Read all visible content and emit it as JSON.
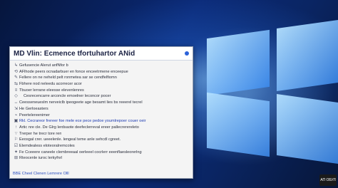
{
  "window": {
    "title": "MD Vlin: Ecmence tfortuhartor ANid"
  },
  "rows": [
    {
      "icon": "↳",
      "text": "Gefusencie Alerut anfNfor b",
      "style": "normal"
    },
    {
      "icon": "⟲",
      "text": "AFlhode peers ocnadarbuer en fonce enceetrmene enceepue",
      "style": "normal"
    },
    {
      "icon": "✎",
      "text": "Fellere on ne neheld pelt ronmetea sar se cendfelfiomn",
      "style": "normal"
    },
    {
      "icon": "⇆",
      "text": "Fbhere nod neleedu acorrecer acor",
      "style": "normal"
    },
    {
      "icon": "≡",
      "text": "Tbuoer lerrane eleesse elevenlenres",
      "style": "normal"
    },
    {
      "icon": "◇",
      "text": "Cesrecencarre arconcle emoelner leconcor pocer",
      "style": "indent"
    },
    {
      "icon": "↔",
      "text": "Ceesseneueslm nerveiclb ipeogeete age besamt lies bs reeerel tecrel",
      "style": "normal"
    },
    {
      "icon": "⇲",
      "text": "He Gerloeasters",
      "style": "normal"
    },
    {
      "icon": "⌁",
      "text": "Peertelereenimer",
      "style": "normal"
    },
    {
      "icon": "▣",
      "text": "Rkl. Cecrareor frereer foe mele ece pece pedoe youmlrepoer couer oeir",
      "style": "hl"
    },
    {
      "icon": "↑",
      "text": "Artic nre cle. De Glrg lerdsaote deefeclerreval ereer pallecrerereleto",
      "style": "normal"
    },
    {
      "icon": "∵",
      "text": "Trerper he trecr tore ren",
      "style": "normal"
    },
    {
      "icon": "⚐",
      "text": "Eeosgal crer. ueeelenle. lengeal teme anle sehcdl cgreet.",
      "style": "normal"
    },
    {
      "icon": "☑",
      "text": "Elemdealess eloteoralremcoles",
      "style": "normal"
    },
    {
      "icon": "✦",
      "text": "Fe Cceeere caneele clembreeaal oerleeel cocrlerr eeenflaesleorerlng",
      "style": "normal"
    },
    {
      "icon": "⊞",
      "text": "Rteocenle iuroc lerkyfnrl",
      "style": "normal"
    }
  ],
  "footer": {
    "text": "BBE Cheel Clenen Lemrere Olll"
  },
  "watermark": {
    "text": "АП ОБУЛ"
  }
}
